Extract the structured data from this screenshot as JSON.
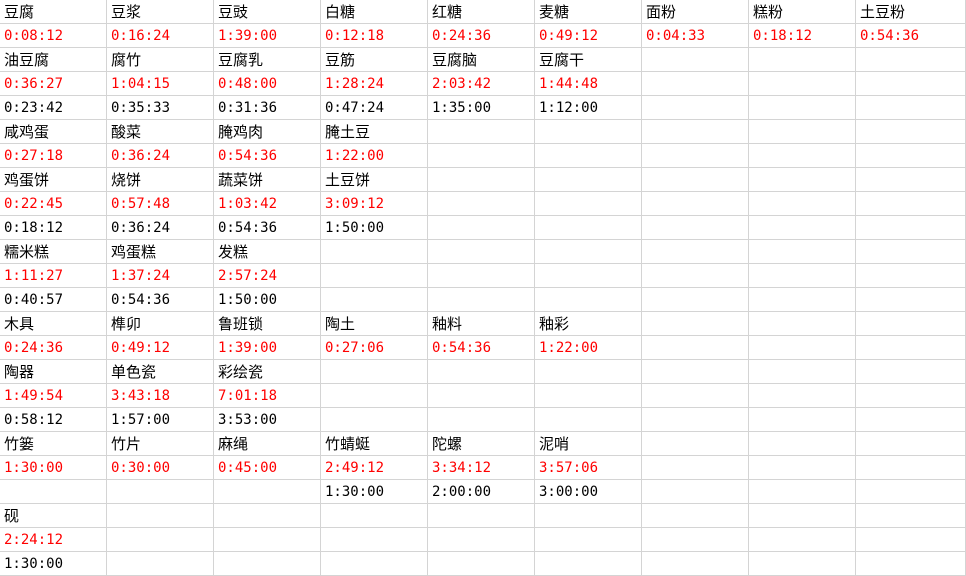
{
  "colors": {
    "cooking_time": "#ff0000",
    "base_time": "#000000",
    "grid": "#d4d4d4"
  },
  "rows": [
    {
      "type": "name",
      "cells": [
        "豆腐",
        "豆浆",
        "豆豉",
        "白糖",
        "红糖",
        "麦糖",
        "面粉",
        "糕粉",
        "土豆粉"
      ]
    },
    {
      "type": "red",
      "cells": [
        "0:08:12",
        "0:16:24",
        "1:39:00",
        "0:12:18",
        "0:24:36",
        "0:49:12",
        "0:04:33",
        "0:18:12",
        "0:54:36"
      ]
    },
    {
      "type": "name",
      "cells": [
        "油豆腐",
        "腐竹",
        "豆腐乳",
        "豆筋",
        "豆腐脑",
        "豆腐干",
        "",
        "",
        ""
      ]
    },
    {
      "type": "red",
      "cells": [
        "0:36:27",
        "1:04:15",
        "0:48:00",
        "1:28:24",
        "2:03:42",
        "1:44:48",
        "",
        "",
        ""
      ]
    },
    {
      "type": "black",
      "cells": [
        "0:23:42",
        "0:35:33",
        "0:31:36",
        "0:47:24",
        "1:35:00",
        "1:12:00",
        "",
        "",
        ""
      ]
    },
    {
      "type": "name",
      "cells": [
        "咸鸡蛋",
        "酸菜",
        "腌鸡肉",
        "腌土豆",
        "",
        "",
        "",
        "",
        ""
      ]
    },
    {
      "type": "red",
      "cells": [
        "0:27:18",
        "0:36:24",
        "0:54:36",
        "1:22:00",
        "",
        "",
        "",
        "",
        ""
      ]
    },
    {
      "type": "name",
      "cells": [
        "鸡蛋饼",
        "烧饼",
        "蔬菜饼",
        "土豆饼",
        "",
        "",
        "",
        "",
        ""
      ]
    },
    {
      "type": "red",
      "cells": [
        "0:22:45",
        "0:57:48",
        "1:03:42",
        "3:09:12",
        "",
        "",
        "",
        "",
        ""
      ]
    },
    {
      "type": "black",
      "cells": [
        "0:18:12",
        "0:36:24",
        "0:54:36",
        "1:50:00",
        "",
        "",
        "",
        "",
        ""
      ]
    },
    {
      "type": "name",
      "cells": [
        "糯米糕",
        "鸡蛋糕",
        "发糕",
        "",
        "",
        "",
        "",
        "",
        ""
      ]
    },
    {
      "type": "red",
      "cells": [
        "1:11:27",
        "1:37:24",
        "2:57:24",
        "",
        "",
        "",
        "",
        "",
        ""
      ]
    },
    {
      "type": "black",
      "cells": [
        "0:40:57",
        "0:54:36",
        "1:50:00",
        "",
        "",
        "",
        "",
        "",
        ""
      ]
    },
    {
      "type": "name",
      "cells": [
        "木具",
        "榫卯",
        "鲁班锁",
        "陶土",
        "釉料",
        "釉彩",
        "",
        "",
        ""
      ]
    },
    {
      "type": "red",
      "cells": [
        "0:24:36",
        "0:49:12",
        "1:39:00",
        "0:27:06",
        "0:54:36",
        "1:22:00",
        "",
        "",
        ""
      ]
    },
    {
      "type": "name",
      "cells": [
        "陶器",
        "单色瓷",
        "彩绘瓷",
        "",
        "",
        "",
        "",
        "",
        ""
      ]
    },
    {
      "type": "red",
      "cells": [
        "1:49:54",
        "3:43:18",
        "7:01:18",
        "",
        "",
        "",
        "",
        "",
        ""
      ]
    },
    {
      "type": "black",
      "cells": [
        "0:58:12",
        "1:57:00",
        "3:53:00",
        "",
        "",
        "",
        "",
        "",
        ""
      ]
    },
    {
      "type": "name",
      "cells": [
        "竹篓",
        "竹片",
        "麻绳",
        "竹蜻蜓",
        "陀螺",
        "泥哨",
        "",
        "",
        ""
      ]
    },
    {
      "type": "red",
      "cells": [
        "1:30:00",
        "0:30:00",
        "0:45:00",
        "2:49:12",
        "3:34:12",
        "3:57:06",
        "",
        "",
        ""
      ]
    },
    {
      "type": "black",
      "cells": [
        "",
        "",
        "",
        "1:30:00",
        "2:00:00",
        "3:00:00",
        "",
        "",
        ""
      ]
    },
    {
      "type": "name",
      "cells": [
        "砚",
        "",
        "",
        "",
        "",
        "",
        "",
        "",
        ""
      ]
    },
    {
      "type": "red",
      "cells": [
        "2:24:12",
        "",
        "",
        "",
        "",
        "",
        "",
        "",
        ""
      ]
    },
    {
      "type": "black",
      "cells": [
        "1:30:00",
        "",
        "",
        "",
        "",
        "",
        "",
        "",
        ""
      ]
    }
  ]
}
